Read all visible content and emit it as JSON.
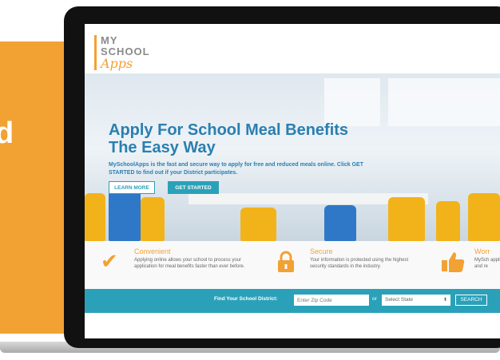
{
  "promo": {
    "partial_letter": "d"
  },
  "logo": {
    "line1": "MY",
    "line2": "SCHOOL",
    "line3": "Apps"
  },
  "hero": {
    "title": "Apply For School Meal Benefits The Easy Way",
    "subtitle": "MySchoolApps is the fast and secure way to apply for free and reduced meals online. Click GET STARTED to find out if your District participates.",
    "learn_more": "LEARN MORE",
    "get_started": "GET STARTED"
  },
  "features": [
    {
      "title": "Convenient",
      "description": "Applying online allows your school to process your application for meal benefits faster than ever before.",
      "icon": "checkmark-icon"
    },
    {
      "title": "Secure",
      "description": "Your information is protected using the highest security standards in the industry.",
      "icon": "padlock-icon"
    },
    {
      "title": "Worr",
      "description": "MySch applic and re",
      "icon": "thumbs-up-icon"
    }
  ],
  "search": {
    "label": "Find Your School District:",
    "zip_placeholder": "Enter Zip Code",
    "or": "or",
    "state_value": "Select State",
    "button": "SEARCH"
  },
  "colors": {
    "accent_orange": "#f2a133",
    "teal": "#2aa1b9",
    "title_blue": "#2a7fb0"
  }
}
